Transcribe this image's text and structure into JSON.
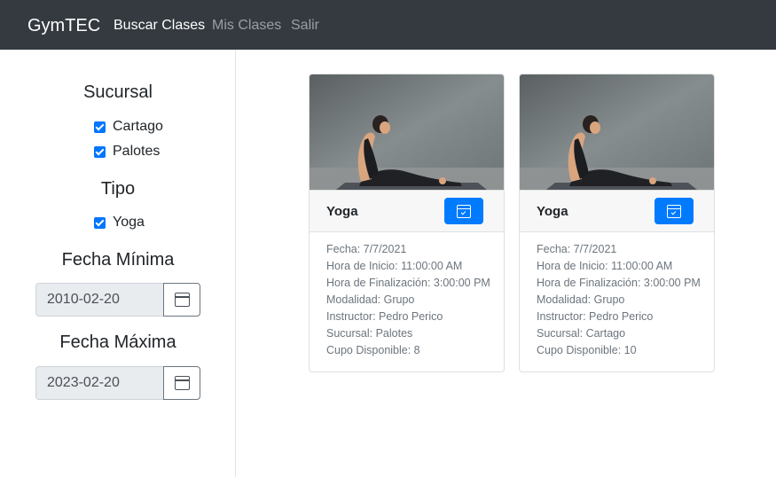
{
  "navbar": {
    "brand": "GymTEC",
    "links": [
      {
        "label": "Buscar Clases",
        "active": true
      },
      {
        "label": "Mis Clases",
        "active": false
      },
      {
        "label": "Salir",
        "active": false
      }
    ]
  },
  "filters": {
    "sucursal_heading": "Sucursal",
    "sucursales": [
      {
        "label": "Cartago",
        "checked": true
      },
      {
        "label": "Palotes",
        "checked": true
      }
    ],
    "tipo_heading": "Tipo",
    "tipos": [
      {
        "label": "Yoga",
        "checked": true
      }
    ],
    "fecha_min_heading": "Fecha Mínima",
    "fecha_min_value": "2010-02-20",
    "fecha_max_heading": "Fecha Máxima",
    "fecha_max_value": "2023-02-20"
  },
  "classes": [
    {
      "title": "Yoga",
      "fecha": "Fecha: 7/7/2021",
      "hora_inicio": "Hora de Inicio: 11:00:00 AM",
      "hora_fin": "Hora de Finalización: 3:00:00 PM",
      "modalidad": "Modalidad: Grupo",
      "instructor": "Instructor: Pedro Perico",
      "sucursal": "Sucursal: Palotes",
      "cupo": "Cupo Disponible: 8"
    },
    {
      "title": "Yoga",
      "fecha": "Fecha: 7/7/2021",
      "hora_inicio": "Hora de Inicio: 11:00:00 AM",
      "hora_fin": "Hora de Finalización: 3:00:00 PM",
      "modalidad": "Modalidad: Grupo",
      "instructor": "Instructor: Pedro Perico",
      "sucursal": "Sucursal: Cartago",
      "cupo": "Cupo Disponible: 10"
    }
  ],
  "colors": {
    "navbar_bg": "#343a40",
    "primary": "#007bff",
    "checkbox": "#0075ff"
  }
}
